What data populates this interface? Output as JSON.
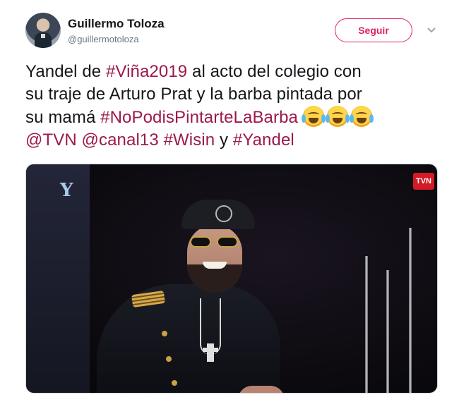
{
  "user": {
    "display_name": "Guillermo Toloza",
    "handle": "@guillermotoloza"
  },
  "follow_button": {
    "label": "Seguir"
  },
  "tweet": {
    "line1": {
      "pre": "Yandel de ",
      "tag": "#Viña2019",
      "post": " al acto del colegio con"
    },
    "line2": "su traje de Arturo Prat y la barba pintada por",
    "line3": {
      "pre": "su mamá ",
      "tag": "#NoPodisPintarteLaBarba",
      "emoji_count": 3,
      "emoji": "face-with-tears-of-joy"
    },
    "line4": {
      "mention1": "@TVN",
      "mention2": "@canal13",
      "tag1": "#Wisin",
      "connector": " y ",
      "tag2": "#Yandel"
    }
  },
  "media": {
    "channel_logo": "TVN",
    "corner_logo": "Y",
    "description_icon": "video-frame"
  },
  "colors": {
    "link": "#9b1a4c",
    "follow_accent": "#e0245e",
    "text": "#14171a",
    "muted": "#657786"
  }
}
